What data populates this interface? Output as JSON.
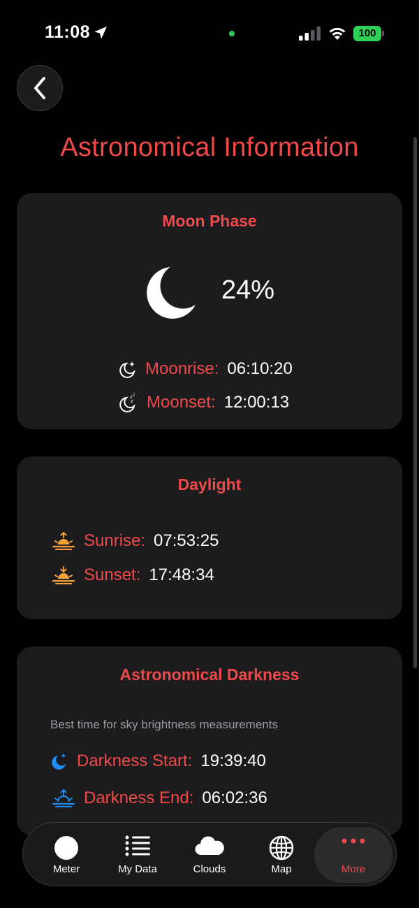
{
  "status_bar": {
    "time": "11:08",
    "battery": "100"
  },
  "page": {
    "title": "Astronomical Information"
  },
  "moon_phase": {
    "title": "Moon Phase",
    "illumination": "24%",
    "moonrise_label": "Moonrise:",
    "moonrise_value": "06:10:20",
    "moonset_label": "Moonset:",
    "moonset_value": "12:00:13"
  },
  "daylight": {
    "title": "Daylight",
    "sunrise_label": "Sunrise:",
    "sunrise_value": "07:53:25",
    "sunset_label": "Sunset:",
    "sunset_value": "17:48:34"
  },
  "darkness": {
    "title": "Astronomical Darkness",
    "subtitle": "Best time for sky brightness measurements",
    "start_label": "Darkness Start:",
    "start_value": "19:39:40",
    "end_label": "Darkness End:",
    "end_value": "06:02:36"
  },
  "tab_bar": {
    "items": [
      {
        "label": "Meter",
        "icon": "circle-icon"
      },
      {
        "label": "My Data",
        "icon": "list-icon"
      },
      {
        "label": "Clouds",
        "icon": "cloud-icon"
      },
      {
        "label": "Map",
        "icon": "globe-icon"
      },
      {
        "label": "More",
        "icon": "more-dots-icon",
        "active": true
      }
    ]
  },
  "colors": {
    "accent_red": "#ef4a4a",
    "sun_orange": "#f5a13c",
    "darkness_blue": "#1e8cf0",
    "card_bg": "#1c1c1e",
    "battery_green": "#30d158"
  }
}
